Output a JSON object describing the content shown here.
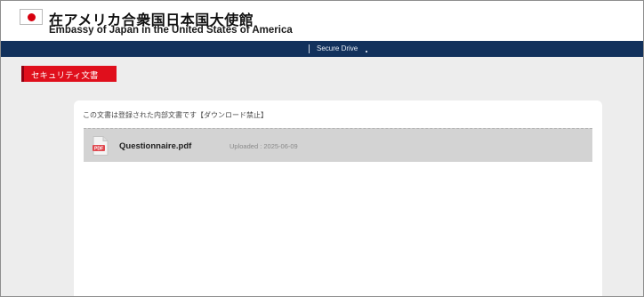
{
  "header": {
    "title_jp": "在アメリカ合衆国日本国大使館",
    "title_en": "Embassy of Japan in the United States of America",
    "flag_icon": "japan-flag-icon"
  },
  "nav": {
    "link_label": "Secure Drive"
  },
  "section": {
    "badge_label": "セキュリティ文書"
  },
  "content": {
    "notice": "この文書は登録された内部文書です【ダウンロード禁止】",
    "files": [
      {
        "name": "Questionnaire.pdf",
        "uploaded": "Uploaded : 2025-06-09",
        "icon": "pdf-file-icon"
      }
    ]
  },
  "colors": {
    "flag_red": "#d7000f",
    "navbar": "#12315c",
    "badge_red": "#e00f1c",
    "pdf_red": "#e0484f"
  }
}
